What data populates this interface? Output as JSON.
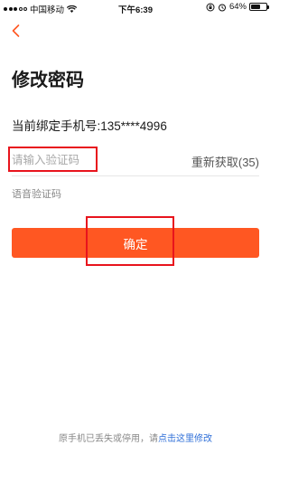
{
  "status_bar": {
    "carrier": "中国移动",
    "time": "下午6:39",
    "battery_percent": "64%",
    "battery_level": 0.64
  },
  "header": {
    "back_icon": "chevron-left-icon",
    "accent_color": "#ff5722"
  },
  "page": {
    "title": "修改密码",
    "bound_phone_text": "当前绑定手机号:135****4996"
  },
  "form": {
    "code_input_placeholder": "请输入验证码",
    "code_input_value": "",
    "resend_label": "重新获取(35)",
    "voice_code_label": "语音验证码",
    "confirm_label": "确定"
  },
  "footer": {
    "tip_prefix": "原手机已丢失或停用，请",
    "tip_link": "点击这里修改"
  },
  "colors": {
    "accent": "#ff5722",
    "link": "#2f6fd8",
    "annotation": "#e8141d"
  }
}
